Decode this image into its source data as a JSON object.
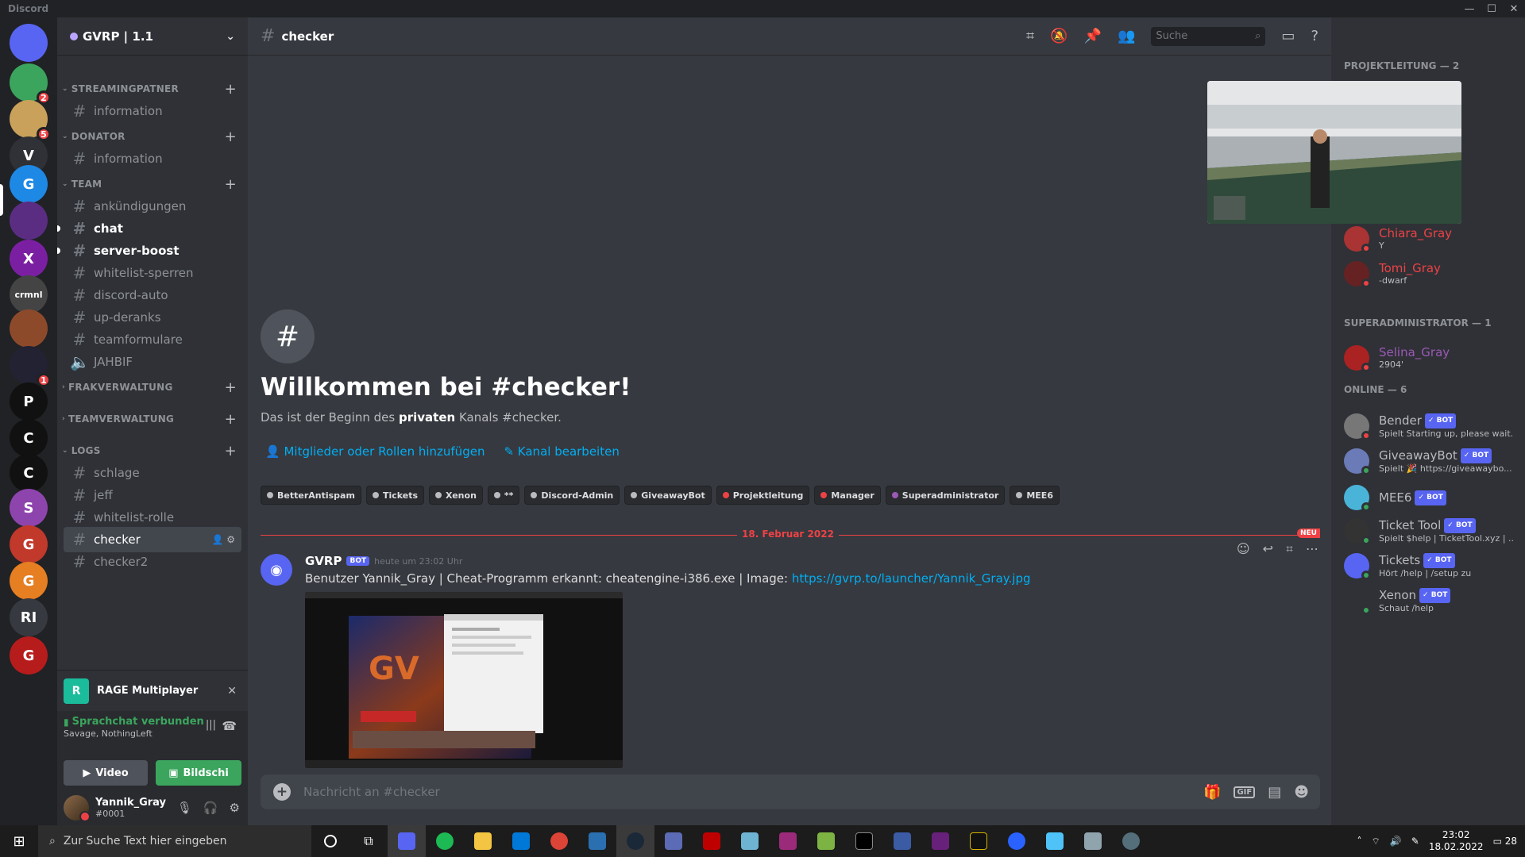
{
  "window": {
    "title": "Discord"
  },
  "guild": {
    "name": "GVRP | 1.1"
  },
  "servers": [
    {
      "label": "",
      "color": "#5865f2",
      "badge": ""
    },
    {
      "label": "",
      "color": "#3ba55d",
      "badge": "2"
    },
    {
      "label": "",
      "color": "#c9a15a",
      "badge": "5"
    },
    {
      "label": "V",
      "color": "#2f3136",
      "badge": ""
    },
    {
      "label": "G",
      "color": "#1e88e5",
      "badge": ""
    },
    {
      "label": "",
      "color": "#5a2d82",
      "badge": ""
    },
    {
      "label": "X",
      "color": "#7b1fa2",
      "badge": ""
    },
    {
      "label": "crmnl",
      "color": "#444",
      "badge": ""
    },
    {
      "label": "",
      "color": "#8d4a2b",
      "badge": ""
    },
    {
      "label": "",
      "color": "#223",
      "badge": "1"
    },
    {
      "label": "P",
      "color": "#111",
      "badge": ""
    },
    {
      "label": "C",
      "color": "#111",
      "badge": ""
    },
    {
      "label": "C",
      "color": "#111",
      "badge": ""
    },
    {
      "label": "S",
      "color": "#8e44ad",
      "badge": ""
    },
    {
      "label": "G",
      "color": "#c0392b",
      "badge": ""
    },
    {
      "label": "G",
      "color": "#e67e22",
      "badge": ""
    },
    {
      "label": "RI",
      "color": "#36393f",
      "badge": ""
    },
    {
      "label": "G",
      "color": "#b71c1c",
      "badge": ""
    }
  ],
  "categories": {
    "streaming": "STREAMINGPATNER",
    "donator": "DONATOR",
    "team": "TEAM",
    "frak": "FRAKVERWALTUNG",
    "teamverw": "TEAMVERWALTUNG",
    "logs": "LOGS"
  },
  "channels": {
    "stream_info": "information",
    "donator_info": "information",
    "ankuendigungen": "ankündigungen",
    "chat": "chat",
    "server_boost": "server-boost",
    "whitelist_sperren": "whitelist-sperren",
    "discord_auto": "discord-auto",
    "up_deranks": "up-deranks",
    "teamformulare": "teamformulare",
    "jahbif": "JAHBIF",
    "schlage": "schlage",
    "jeff": "jeff",
    "whitelist_rolle": "whitelist-rolle",
    "checker": "checker",
    "checker2": "checker2"
  },
  "activity": {
    "name": "RAGE Multiplayer"
  },
  "voice": {
    "status": "Sprachchat verbunden",
    "sub": "Savage, NothingLeft",
    "video": "Video",
    "screen": "Bildschi"
  },
  "user": {
    "name": "Yannik_Gray",
    "tag": "#0001"
  },
  "header": {
    "channel": "checker",
    "search_placeholder": "Suche"
  },
  "welcome": {
    "title": "Willkommen bei #checker!",
    "sub_pre": "Das ist der Beginn des ",
    "sub_bold": "privaten",
    "sub_post": " Kanals #checker.",
    "add_members": "Mitglieder oder Rollen hinzufügen",
    "edit_channel": "Kanal bearbeiten"
  },
  "roles": [
    {
      "name": "BetterAntispam",
      "color": "#b9bbbe"
    },
    {
      "name": "Tickets",
      "color": "#b9bbbe"
    },
    {
      "name": "Xenon",
      "color": "#b9bbbe"
    },
    {
      "name": "**",
      "color": "#b9bbbe"
    },
    {
      "name": "Discord-Admin",
      "color": "#b9bbbe"
    },
    {
      "name": "GiveawayBot",
      "color": "#b9bbbe"
    },
    {
      "name": "Projektleitung",
      "color": "#ed4245"
    },
    {
      "name": "Manager",
      "color": "#ed4245"
    },
    {
      "name": "Superadministrator",
      "color": "#9b59b6"
    },
    {
      "name": "MEE6",
      "color": "#b9bbbe"
    }
  ],
  "divider": {
    "date": "18. Februar 2022",
    "new": "NEU"
  },
  "message": {
    "author": "GVRP",
    "bot": "BOT",
    "time": "heute um 23:02 Uhr",
    "text": "Benutzer Yannik_Gray | Cheat-Programm erkannt: cheatengine-i386.exe | Image: ",
    "link": "https://gvrp.to/launcher/Yannik_Gray.jpg"
  },
  "composer": {
    "placeholder": "Nachricht an #checker",
    "gif": "GIF"
  },
  "member_groups": {
    "projekt": "PROJEKTLEITUNG — 2",
    "superadmin": "SUPERADMINISTRATOR — 1",
    "online": "ONLINE — 6"
  },
  "members": [
    {
      "name": "Chiara_Gray",
      "activity": "Y",
      "color": "#ed4245",
      "avatar": "#a33",
      "status": "#ed4245",
      "bot": ""
    },
    {
      "name": "Tomi_Gray",
      "activity": "-dwarf",
      "color": "#ed4245",
      "avatar": "#622",
      "status": "#ed4245",
      "bot": ""
    },
    {
      "name": "Selina_Gray",
      "activity": "2904'",
      "color": "#9b59b6",
      "avatar": "#a22",
      "status": "#ed4245",
      "bot": ""
    },
    {
      "name": "Bender",
      "activity": "Spielt Starting up, please wait...",
      "color": "#b9bbbe",
      "avatar": "#777",
      "status": "#ed4245",
      "bot": "✓ BOT"
    },
    {
      "name": "GiveawayBot",
      "activity": "Spielt 🎉 https://giveawaybo...",
      "color": "#b9bbbe",
      "avatar": "#6b7bb8",
      "status": "#3ba55d",
      "bot": "✓ BOT"
    },
    {
      "name": "MEE6",
      "activity": "",
      "color": "#b9bbbe",
      "avatar": "#4ab3d8",
      "status": "#3ba55d",
      "bot": "✓ BOT"
    },
    {
      "name": "Ticket Tool",
      "activity": "Spielt $help | TicketTool.xyz | ...",
      "color": "#b9bbbe",
      "avatar": "#333",
      "status": "#3ba55d",
      "bot": "✓ BOT"
    },
    {
      "name": "Tickets",
      "activity": "Hört /help | /setup zu",
      "color": "#b9bbbe",
      "avatar": "#5865f2",
      "status": "#3ba55d",
      "bot": "✓ BOT"
    },
    {
      "name": "Xenon",
      "activity": "Schaut /help",
      "color": "#b9bbbe",
      "avatar": "#2f3136",
      "status": "#3ba55d",
      "bot": "✓ BOT"
    }
  ],
  "taskbar": {
    "search_placeholder": "Zur Suche Text hier eingeben",
    "time": "23:02",
    "date": "18.02.2022",
    "notif": "28"
  }
}
